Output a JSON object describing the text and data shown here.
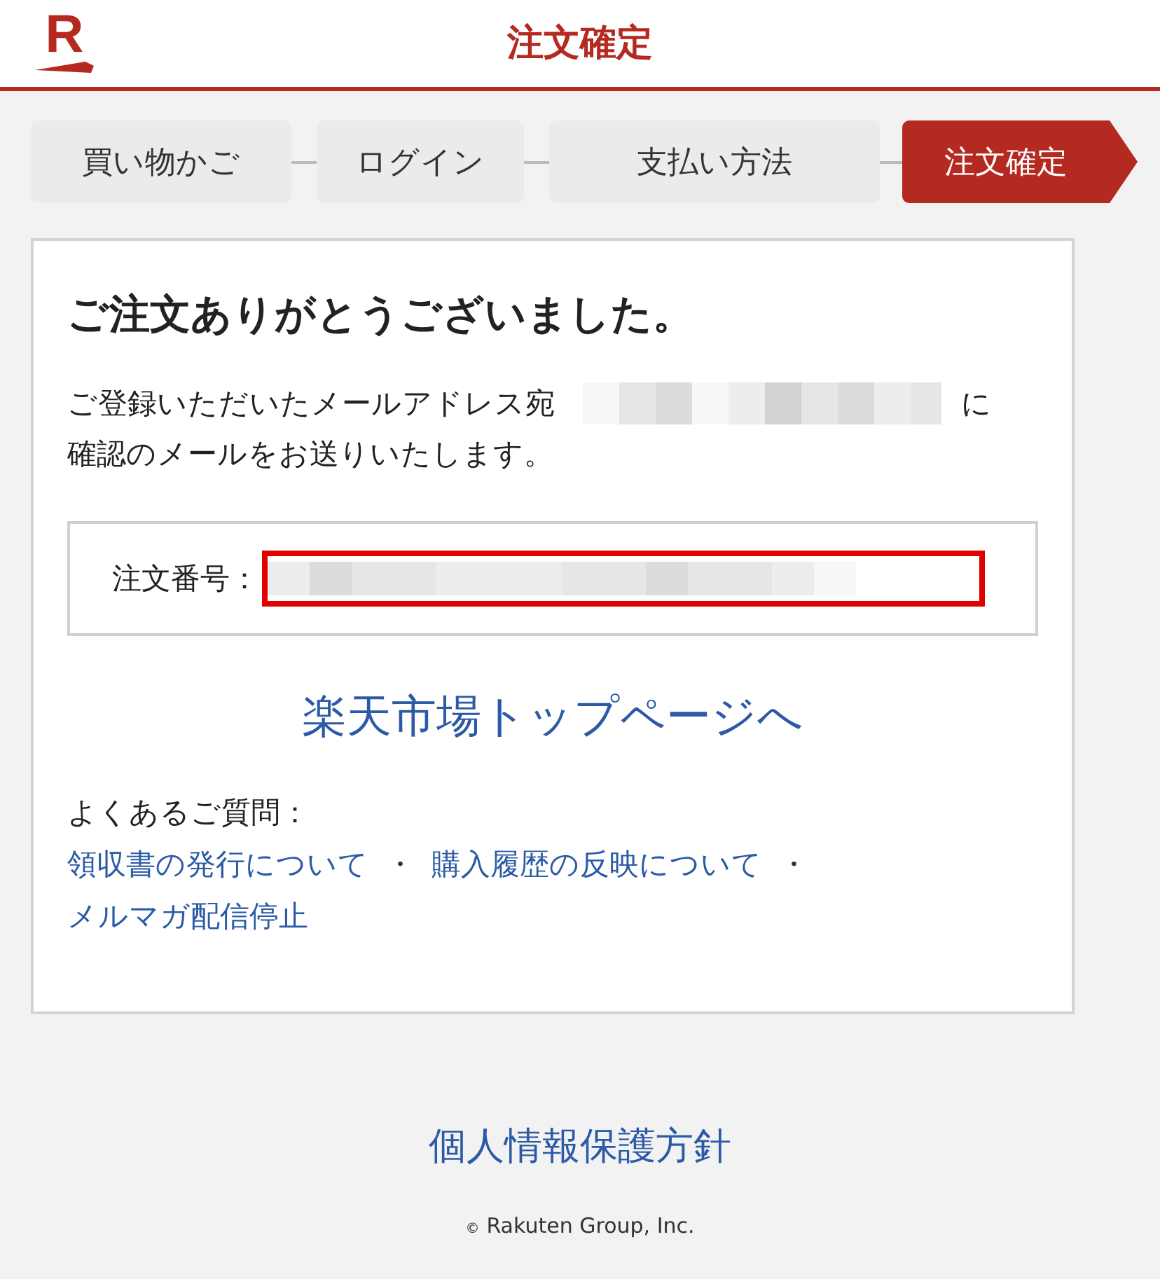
{
  "header": {
    "logo": "R",
    "title": "注文確定"
  },
  "steps": [
    {
      "label": "買い物かご",
      "selected": false
    },
    {
      "label": "ログイン",
      "selected": false
    },
    {
      "label": "支払い方法",
      "selected": false
    },
    {
      "label": "注文確定",
      "selected": true
    }
  ],
  "card": {
    "heading": "ご注文ありがとうございました。",
    "message_lines": [
      "ご登録いただいたメールアドレス宛",
      "に",
      "確認のメールをお送りいたします。"
    ],
    "order_label": "注文番号：",
    "order_highlighted": true,
    "top_link": "楽天市場トップページへ",
    "faq_label": "よくあるご質問：",
    "faq_links": [
      "領収書の発行について",
      "購入履歴の反映について",
      "メルマガ配信停止"
    ],
    "faq_separators": [
      "・",
      "・"
    ]
  },
  "footer": {
    "privacy_link": "個人情報保護方針",
    "copyright_mark": "©",
    "copyright": "Rakuten Group, Inc."
  }
}
